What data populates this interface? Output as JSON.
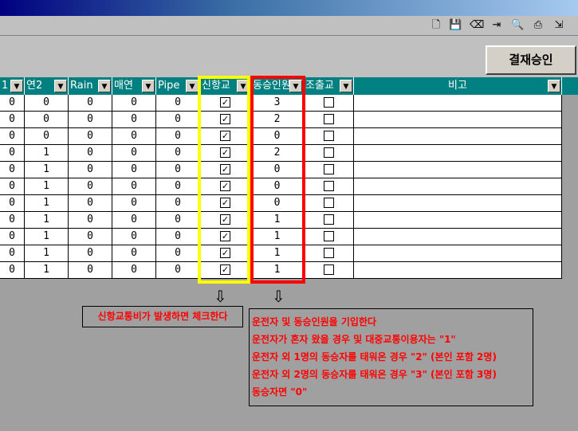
{
  "toolbar": {
    "icons": [
      "new-document-icon",
      "save-icon",
      "eraser-icon",
      "export-icon",
      "preview-icon",
      "print-icon",
      "exit-icon"
    ]
  },
  "panel": {
    "approve_label": "결재승인"
  },
  "grid": {
    "columns": [
      "1",
      "연2",
      "Rain",
      "매연",
      "Pipe",
      "신항교",
      "동승인원",
      "조출교",
      "비고"
    ],
    "rows": [
      {
        "c1": "0",
        "c2": "0",
        "c3": "0",
        "c4": "0",
        "c5": "0",
        "shinhang": true,
        "passengers": "3",
        "early": false
      },
      {
        "c1": "0",
        "c2": "0",
        "c3": "0",
        "c4": "0",
        "c5": "0",
        "shinhang": true,
        "passengers": "2",
        "early": false
      },
      {
        "c1": "0",
        "c2": "0",
        "c3": "0",
        "c4": "0",
        "c5": "0",
        "shinhang": true,
        "passengers": "0",
        "early": false
      },
      {
        "c1": "0",
        "c2": "1",
        "c3": "0",
        "c4": "0",
        "c5": "0",
        "shinhang": true,
        "passengers": "2",
        "early": false
      },
      {
        "c1": "0",
        "c2": "1",
        "c3": "0",
        "c4": "0",
        "c5": "0",
        "shinhang": true,
        "passengers": "0",
        "early": false
      },
      {
        "c1": "0",
        "c2": "1",
        "c3": "0",
        "c4": "0",
        "c5": "0",
        "shinhang": true,
        "passengers": "0",
        "early": false
      },
      {
        "c1": "0",
        "c2": "1",
        "c3": "0",
        "c4": "0",
        "c5": "0",
        "shinhang": true,
        "passengers": "0",
        "early": false
      },
      {
        "c1": "0",
        "c2": "1",
        "c3": "0",
        "c4": "0",
        "c5": "0",
        "shinhang": true,
        "passengers": "1",
        "early": false
      },
      {
        "c1": "0",
        "c2": "1",
        "c3": "0",
        "c4": "0",
        "c5": "0",
        "shinhang": true,
        "passengers": "1",
        "early": false
      },
      {
        "c1": "0",
        "c2": "1",
        "c3": "0",
        "c4": "0",
        "c5": "0",
        "shinhang": true,
        "passengers": "1",
        "early": false
      },
      {
        "c1": "0",
        "c2": "1",
        "c3": "0",
        "c4": "0",
        "c5": "0",
        "shinhang": true,
        "passengers": "1",
        "early": false
      }
    ]
  },
  "annotations": {
    "note1": "신항교통비가 발생하면 체크한다",
    "note2": [
      "운전자 및 동승인원을 기입한다",
      "운전자가 혼자 왔을 경우 및 대중교통이용자는 \"1\"",
      "운전자 외 1명의 동승자를 태워온 경우 \"2\" (본인 포함 2명)",
      "운전자 외 2명의 동승자를 태워온 경우 \"3\" (본인 포함 3명)",
      "동승자면 \"0\""
    ],
    "colors": {
      "yellow_box": "#ffff00",
      "red_box": "#ff0000",
      "note_text": "#ff0000",
      "header_bg": "#008080"
    }
  }
}
